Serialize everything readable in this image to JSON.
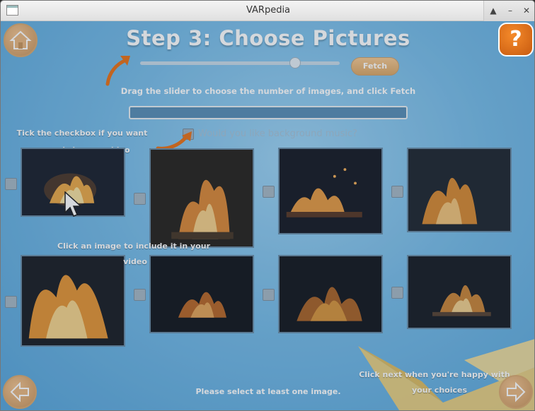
{
  "window": {
    "title": "VARpedia",
    "controls": [
      "up-icon",
      "minimize-icon",
      "close-icon"
    ]
  },
  "header": {
    "title": "Step 3: Choose Pictures",
    "help_label": "?"
  },
  "slider": {
    "fetch_label": "Fetch",
    "value_fraction": 0.77
  },
  "instructions": {
    "main": "Drag the slider to choose the number of images, and click Fetch"
  },
  "search_field": {
    "value": ""
  },
  "music": {
    "label": "Would you like background music?",
    "checked": false
  },
  "hints": {
    "checkbox_line1": "Tick the checkbox if you want",
    "checkbox_line2": "music in your video",
    "image_line1": "Click an image to include it in your",
    "image_line2": "video",
    "next_line1": "Click next when you're happy with",
    "next_line2": "your choices"
  },
  "images": [
    {
      "name": "fire-image-1",
      "checked": false
    },
    {
      "name": "fire-image-2",
      "checked": false
    },
    {
      "name": "fire-image-3",
      "checked": false
    },
    {
      "name": "fire-image-4",
      "checked": false
    },
    {
      "name": "fire-image-5",
      "checked": false
    },
    {
      "name": "fire-image-6",
      "checked": false
    },
    {
      "name": "fire-image-7",
      "checked": false
    },
    {
      "name": "fire-image-8",
      "checked": false
    }
  ],
  "status": {
    "message": "Please select at least one image."
  },
  "nav": {
    "home_icon": "home-icon",
    "back_icon": "back-arrow-icon",
    "next_icon": "next-arrow-icon"
  },
  "colors": {
    "accent_orange": "#e8731a",
    "background_blue": "#78bce7"
  }
}
